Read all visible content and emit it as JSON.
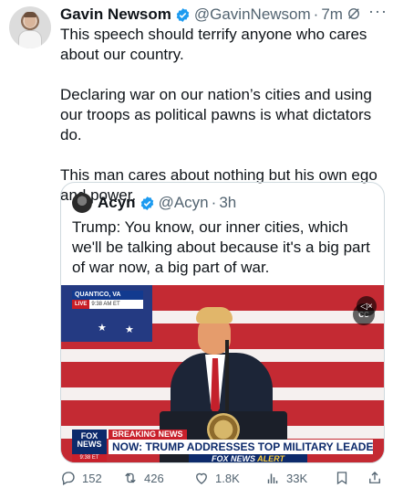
{
  "tweet": {
    "author_name": "Gavin Newsom",
    "handle": "@GavinNewsom",
    "separator": "·",
    "time": "7m",
    "more": "···",
    "paragraphs": [
      "This speech should terrify anyone who cares about our country.",
      "Declaring war on our nation’s cities and using our troops as political pawns is what dictators do.",
      "This man cares about nothing but his own ego and power."
    ]
  },
  "quote": {
    "author_name": "Acyn",
    "handle": "@Acyn",
    "separator": "·",
    "time": "3h",
    "text": "Trump: You know, our inner cities, which we'll be talking about because it's a big part of war now, a big part of war."
  },
  "video": {
    "location": "QUANTICO, VA",
    "live": "LIVE",
    "live_time": "9:38 AM ET",
    "cc_label": "CC",
    "network_logo_top": "FOX",
    "network_logo_bottom": "NEWS",
    "network_time": "9:38 ET",
    "breaking": "BREAKING NEWS",
    "headline": "NOW: TRUMP ADDRESSES TOP MILITARY LEADERS",
    "ticker_brand": "FOX NEWS",
    "ticker_alert": "ALERT"
  },
  "actions": {
    "replies": "152",
    "reposts": "426",
    "likes": "1.8K",
    "views": "33K"
  },
  "colors": {
    "verified": "#1d9bf0",
    "secondary_text": "#536471",
    "border": "#cfd9de"
  },
  "icons": [
    "verified-badge-icon",
    "grok-icon",
    "more-icon",
    "reply-icon",
    "repost-icon",
    "like-icon",
    "views-icon",
    "bookmark-icon",
    "share-icon",
    "captions-icon",
    "mute-icon"
  ]
}
